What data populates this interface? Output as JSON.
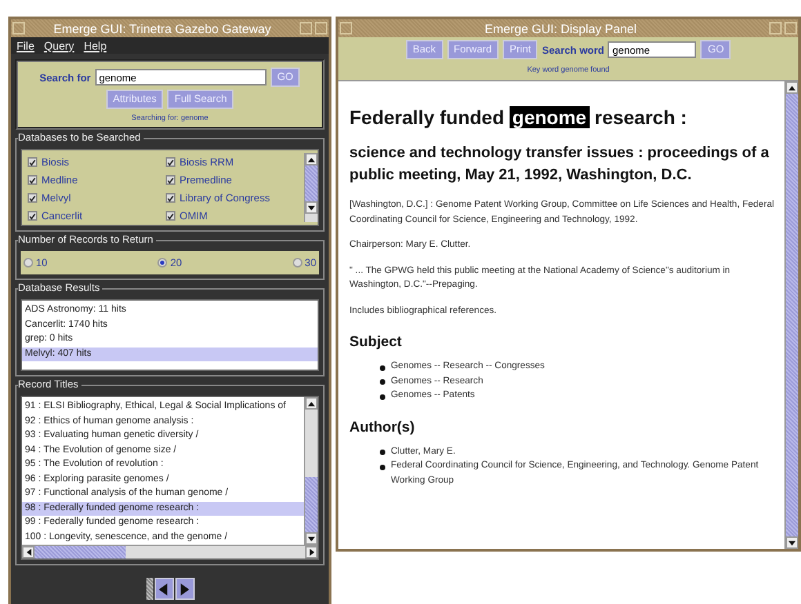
{
  "left_window": {
    "title": "Emerge GUI: Trinetra Gazebo Gateway",
    "menu": [
      "File",
      "Query",
      "Help"
    ],
    "search": {
      "label": "Search for",
      "value": "genome",
      "go": "GO",
      "buttons": [
        "Attributes",
        "Full Search"
      ],
      "status": "Searching for: genome"
    },
    "databases": {
      "title": "Databases to be Searched",
      "items": [
        {
          "label": "Biosis",
          "checked": true
        },
        {
          "label": "Biosis RRM",
          "checked": true
        },
        {
          "label": "Medline",
          "checked": true
        },
        {
          "label": "Premedline",
          "checked": true
        },
        {
          "label": "Melvyl",
          "checked": true
        },
        {
          "label": "Library of Congress",
          "checked": true
        },
        {
          "label": "Cancerlit",
          "checked": true
        },
        {
          "label": "OMIM",
          "checked": true
        }
      ]
    },
    "records": {
      "title": "Number of Records to Return",
      "options": [
        {
          "label": "10",
          "selected": false
        },
        {
          "label": "20",
          "selected": true
        },
        {
          "label": "30",
          "selected": false
        }
      ]
    },
    "results": {
      "title": "Database Results",
      "items": [
        {
          "label": "ADS Astronomy: 11 hits",
          "selected": false
        },
        {
          "label": "Cancerlit: 1740 hits",
          "selected": false
        },
        {
          "label": "grep: 0 hits",
          "selected": false
        },
        {
          "label": "Melvyl: 407 hits",
          "selected": true
        }
      ]
    },
    "titles": {
      "title": "Record Titles",
      "items": [
        {
          "label": "91 : ELSI Bibliography, Ethical, Legal & Social Implications of",
          "selected": false
        },
        {
          "label": "92 : Ethics of human genome analysis :",
          "selected": false
        },
        {
          "label": "93 : Evaluating human genetic diversity /",
          "selected": false
        },
        {
          "label": "94 : The Evolution of genome size /",
          "selected": false
        },
        {
          "label": "95 : The Evolution of revolution :",
          "selected": false
        },
        {
          "label": "96 : Exploring parasite genomes /",
          "selected": false
        },
        {
          "label": "97 : Functional analysis of the human genome /",
          "selected": false
        },
        {
          "label": "98 : Federally funded genome research :",
          "selected": true
        },
        {
          "label": "99 : Federally funded genome research :",
          "selected": false
        },
        {
          "label": "100 : Longevity, senescence, and the genome /",
          "selected": false
        }
      ]
    }
  },
  "right_window": {
    "title": "Emerge GUI: Display Panel",
    "buttons": [
      "Back",
      "Forward",
      "Print"
    ],
    "search": {
      "label": "Search word",
      "value": "genome",
      "go": "GO"
    },
    "status": "Key word genome found",
    "record": {
      "title": [
        {
          "text": "Federally funded",
          "highlight": false
        },
        {
          "text": "genome",
          "highlight": true
        },
        {
          "text": "research :",
          "highlight": false
        }
      ],
      "subtitle": "science and technology transfer issues : proceedings of a public meeting, May 21, 1992, Washington, D.C.",
      "paragraphs": [
        "[Washington, D.C.] : Genome Patent Working Group, Committee on Life Sciences and Health, Federal Coordinating Council for Science, Engineering and Technology, 1992.",
        "Chairperson: Mary E. Clutter.",
        "\" ... The GPWG held this public meeting at the National Academy of Science\"s auditorium in Washington, D.C.\"--Prepaging.",
        "Includes bibliographical references."
      ],
      "sections": [
        {
          "heading": "Subject",
          "items": [
            "Genomes -- Research -- Congresses",
            "Genomes -- Research",
            "Genomes -- Patents"
          ]
        },
        {
          "heading": "Author(s)",
          "items": [
            "Clutter, Mary E.",
            "Federal Coordinating Council for Science, Engineering, and Technology. Genome Patent Working Group"
          ]
        }
      ]
    }
  }
}
